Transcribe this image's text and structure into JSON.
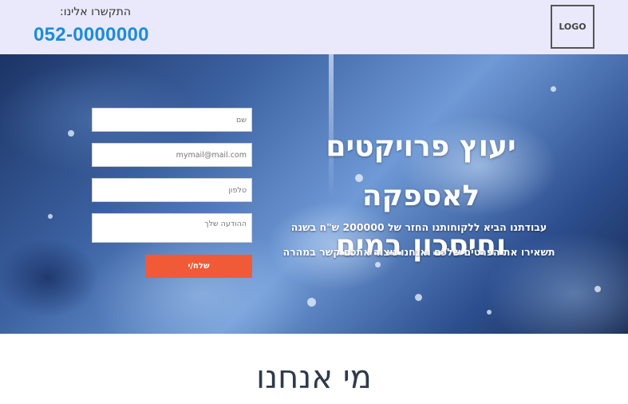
{
  "header": {
    "contact_label": "התקשרו אלינו:",
    "phone": "052-0000000",
    "logo_text": "LOGO"
  },
  "hero": {
    "headline_line1": "יעוץ פרויקטים לאספקה",
    "headline_line2": "וחיסכון במים",
    "sub_line1": "עבודתנו הביא ללקוחותנו החזר של 200000 ש\"ח בשנה",
    "sub_line2": "תשאירו את הפרטים שלכם ואנחנו ניצור אתכם קשר במהרה"
  },
  "form": {
    "name_placeholder": "שם",
    "email_placeholder": "mymail@mail.com",
    "phone_placeholder": "טלפון",
    "message_placeholder": "ההודעה שלך",
    "submit_label": "שלח/י"
  },
  "about": {
    "title": "מי אנחנו"
  },
  "colors": {
    "header_bg": "#e9e9fb",
    "phone": "#1a8cdc",
    "submit": "#f05a37"
  }
}
